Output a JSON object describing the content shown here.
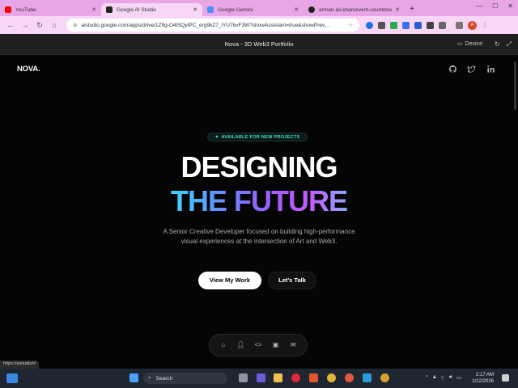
{
  "browser": {
    "tabs": [
      {
        "label": "YouTube",
        "color": "#ff0000"
      },
      {
        "label": "Google AI Studio",
        "color": "#222222"
      },
      {
        "label": "Google Gemini",
        "color": "#4c8df6"
      },
      {
        "label": "arman-ali-khan/event-countdow",
        "color": "#222222"
      }
    ],
    "address": "aistudio.google.com/apps/drive/1Z9g-O4lSQyIPC_erg9kZ7_lYU7bvF3W?showAssistant=true&showPrev..."
  },
  "app_header": {
    "title": "Nova - 3D Web3 Portfolio",
    "device_label": "Device"
  },
  "site": {
    "logo": "NOVA.",
    "badge": "AVAILABLE FOR NEW PROJECTS",
    "heading_line1": "DESIGNING",
    "heading_line2": "THE FUTURE",
    "subtitle": "A Senior Creative Developer focused on building high-performance visual experiences at the intersection of Art and Web3.",
    "primary_cta": "View My Work",
    "secondary_cta": "Let's Talk",
    "social_icons": [
      "github-icon",
      "twitter-icon",
      "linkedin-icon"
    ],
    "dock_icons": [
      "home-icon",
      "user-icon",
      "code-icon",
      "briefcase-icon",
      "mail-icon"
    ]
  },
  "status_url": "https://aistudio/#",
  "taskbar": {
    "search_placeholder": "Search",
    "time": "2:17 AM",
    "date": "1/12/2026"
  }
}
